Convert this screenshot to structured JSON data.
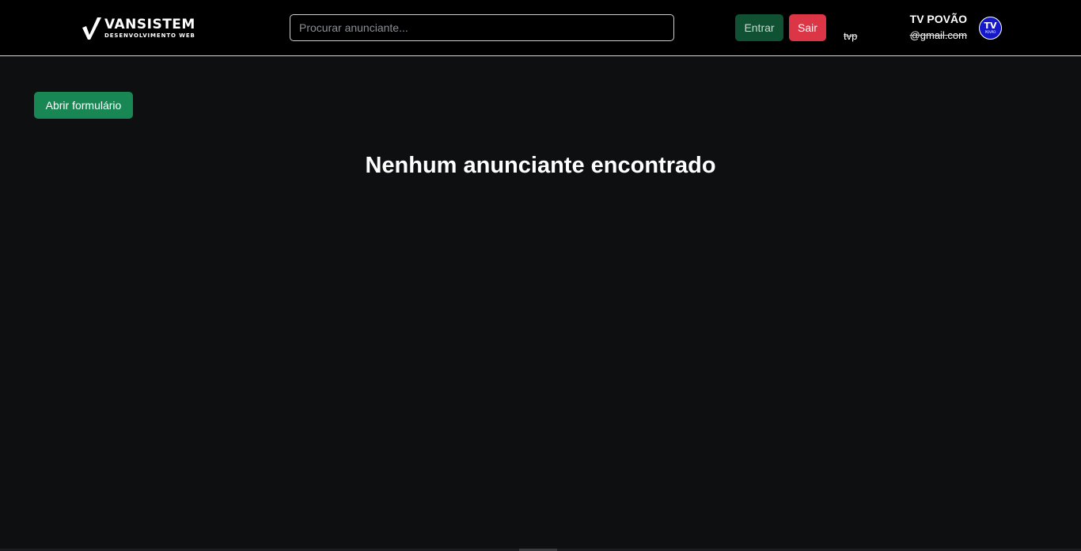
{
  "header": {
    "brand": {
      "name": "VANSISTEM",
      "tagline": "DESENVOLVIMENTO WEB",
      "icon": "v-logo-icon"
    },
    "search": {
      "placeholder": "Procurar anunciante...",
      "value": ""
    },
    "buttons": {
      "login_label": "Entrar",
      "logout_label": "Sair"
    },
    "user": {
      "short": "tvp",
      "name": "TV POVÃO",
      "email": "@gmail.com",
      "avatar": {
        "text": "TV",
        "subtext": "POVÃO"
      }
    }
  },
  "main": {
    "open_form_label": "Abrir formulário",
    "empty_message": "Nenhum anunciante encontrado"
  },
  "colors": {
    "background": "#0e0f11",
    "navbar": "#000000",
    "entrar": "#0f5132",
    "sair": "#dc3545",
    "abrir": "#198754",
    "avatar": "#1518c8"
  }
}
